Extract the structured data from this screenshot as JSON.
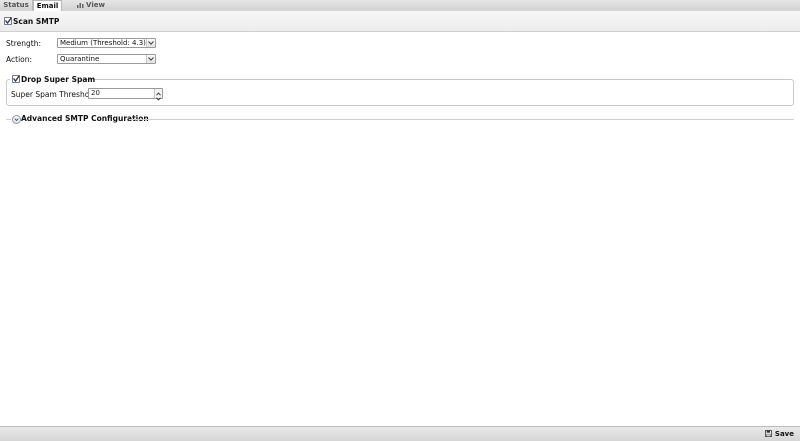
{
  "tabs": [
    {
      "label": "Status"
    },
    {
      "label": "Email",
      "active": true
    },
    {
      "label": "View Reports",
      "icon": "chart-icon"
    }
  ],
  "scan": {
    "label": "Scan SMTP",
    "checked": true
  },
  "strength": {
    "label": "Strength:",
    "value": "Medium (Threshold: 4.3)"
  },
  "action": {
    "label": "Action:",
    "value": "Quarantine"
  },
  "super_spam": {
    "legend": "Drop Super Spam",
    "checked": true,
    "threshold_label": "Super Spam Threshold:",
    "threshold_value": "20"
  },
  "advanced": {
    "label": "Advanced SMTP Configuration",
    "expanded": false
  },
  "toolbar": {
    "save_label": "Save",
    "save_icon": "floppy-disk-icon"
  },
  "colors": {
    "tab_bg": "#d8d8d8",
    "border": "#b8b8b8",
    "checkbox_check": "#2d3a4a"
  }
}
